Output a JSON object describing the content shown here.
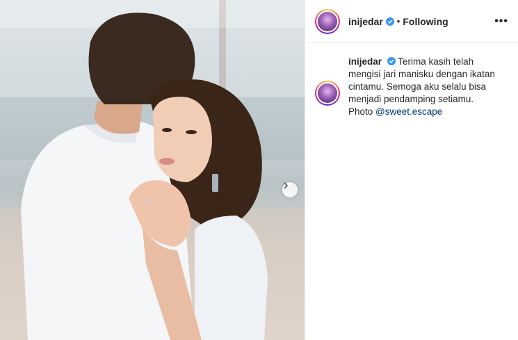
{
  "header": {
    "username": "inijedar",
    "dot": "•",
    "following_label": "Following",
    "more_label": "•••"
  },
  "caption": {
    "username": "inijedar",
    "text": "Terima kasih telah mengisi jari manisku dengan ikatan cintamu. Semoga aku selalu bisa menjadi pendamping setiamu.",
    "credit_prefix": "Photo",
    "mention": "@sweet.escape"
  },
  "icons": {
    "verified": "verified-badge-icon",
    "next": "chevron-right-icon",
    "more": "more-options-icon"
  },
  "colors": {
    "verified": "#3897f0",
    "mention": "#00376b"
  }
}
